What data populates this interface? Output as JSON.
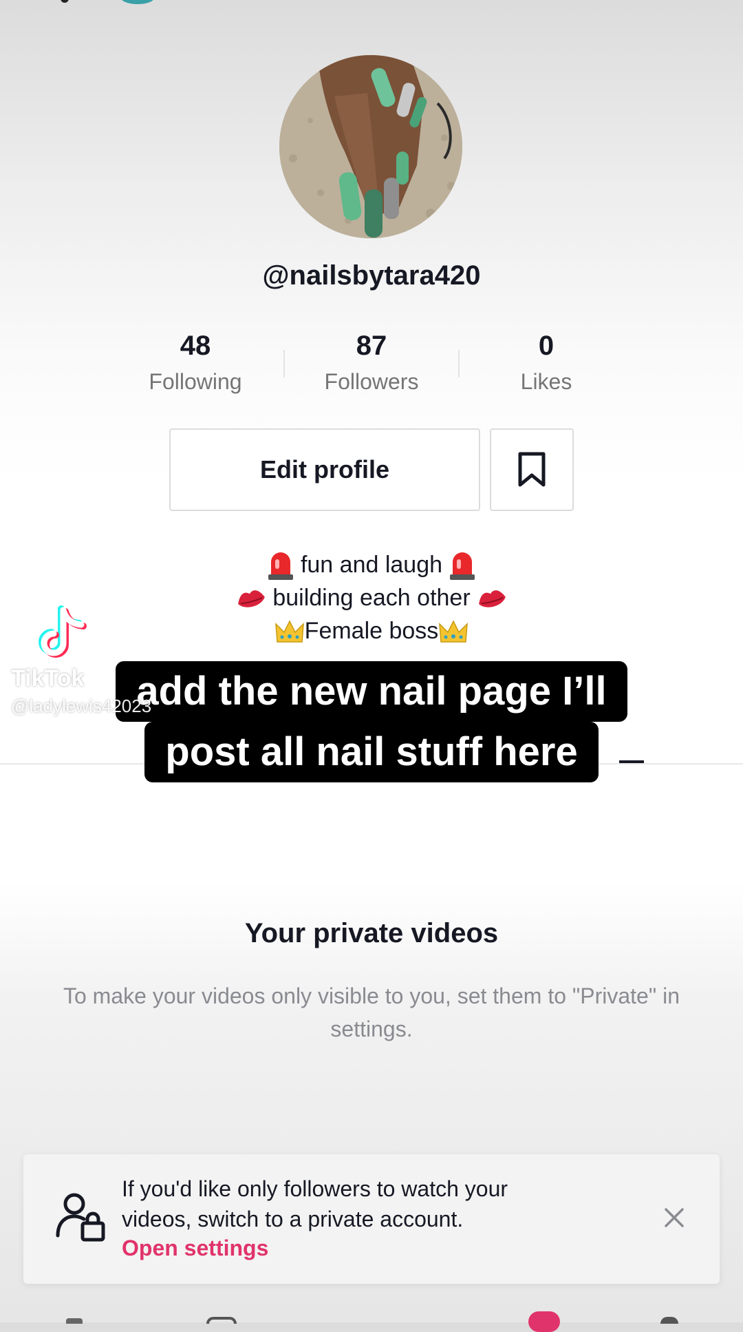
{
  "profile": {
    "username": "@nailsbytara420",
    "stats": [
      {
        "value": "48",
        "label": "Following"
      },
      {
        "value": "87",
        "label": "Followers"
      },
      {
        "value": "0",
        "label": "Likes"
      }
    ],
    "edit_profile_label": "Edit profile",
    "bio_lines": [
      {
        "text": "fun and laugh",
        "emoji": "siren-emoji"
      },
      {
        "text": "building each other",
        "emoji": "kiss-lips-emoji"
      },
      {
        "text": "Female boss",
        "emoji": "crown-emoji"
      }
    ]
  },
  "watermark": {
    "brand": "TikTok",
    "handle": "@ladylewis42023"
  },
  "caption": {
    "line1": "add the new nail page I’ll",
    "line2": "post all nail stuff here"
  },
  "private_videos": {
    "title": "Your private videos",
    "description": "To make your videos only visible to you, set them to \"Private\" in settings."
  },
  "banner": {
    "message": "If you'd like only followers to watch your videos, switch to a private account.",
    "link_label": "Open settings"
  },
  "colors": {
    "accent": "#e1336b",
    "text_primary": "#161823",
    "text_secondary": "#757575"
  }
}
